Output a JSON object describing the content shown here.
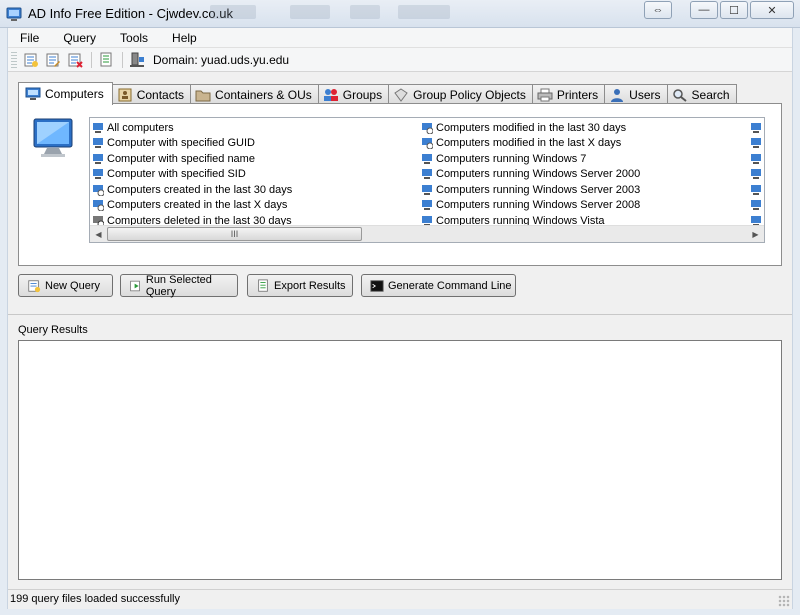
{
  "window": {
    "title": "AD Info Free Edition - Cjwdev.co.uk",
    "buttons": {
      "restore_size": "⇔",
      "minimize": "—",
      "maximize": "☐",
      "close": "✕"
    }
  },
  "menu": [
    "File",
    "Query",
    "Tools",
    "Help"
  ],
  "toolbar": {
    "domain_label": "Domain: yuad.uds.yu.edu",
    "icons": [
      "new-query-icon",
      "edit-query-icon",
      "delete-query-icon",
      "export-icon",
      "domain-icon"
    ]
  },
  "tabs": [
    {
      "label": "Computers",
      "icon": "computer-icon",
      "active": true
    },
    {
      "label": "Contacts",
      "icon": "contacts-icon"
    },
    {
      "label": "Containers & OUs",
      "icon": "folder-icon"
    },
    {
      "label": "Groups",
      "icon": "groups-icon"
    },
    {
      "label": "Group Policy Objects",
      "icon": "gpo-icon"
    },
    {
      "label": "Printers",
      "icon": "printer-icon"
    },
    {
      "label": "Users",
      "icon": "user-icon"
    },
    {
      "label": "Search",
      "icon": "search-icon"
    }
  ],
  "queries": {
    "col1": [
      "All computers",
      "Computer with specified GUID",
      "Computer with specified name",
      "Computer with specified SID",
      "Computers created in the last 30 days",
      "Computers created in the last X days",
      "Computers deleted in the last 30 days"
    ],
    "col2": [
      "Computers modified in the last 30 days",
      "Computers modified in the last X days",
      "Computers running Windows 7",
      "Computers running Windows Server 2000",
      "Computers running Windows Server 2003",
      "Computers running Windows Server 2008",
      "Computers running Windows Vista"
    ],
    "scroll_thumb_grip": "III"
  },
  "actions": {
    "new_query": "New Query",
    "run_selected": "Run Selected Query",
    "export_results": "Export Results",
    "generate_command_line": "Generate Command Line"
  },
  "results": {
    "label": "Query Results"
  },
  "status": {
    "text": "199 query files loaded successfully"
  },
  "colors": {
    "accent": "#3c7fd1",
    "tab_border": "#8d8d8d",
    "window_frame": "#dbe4ef"
  }
}
